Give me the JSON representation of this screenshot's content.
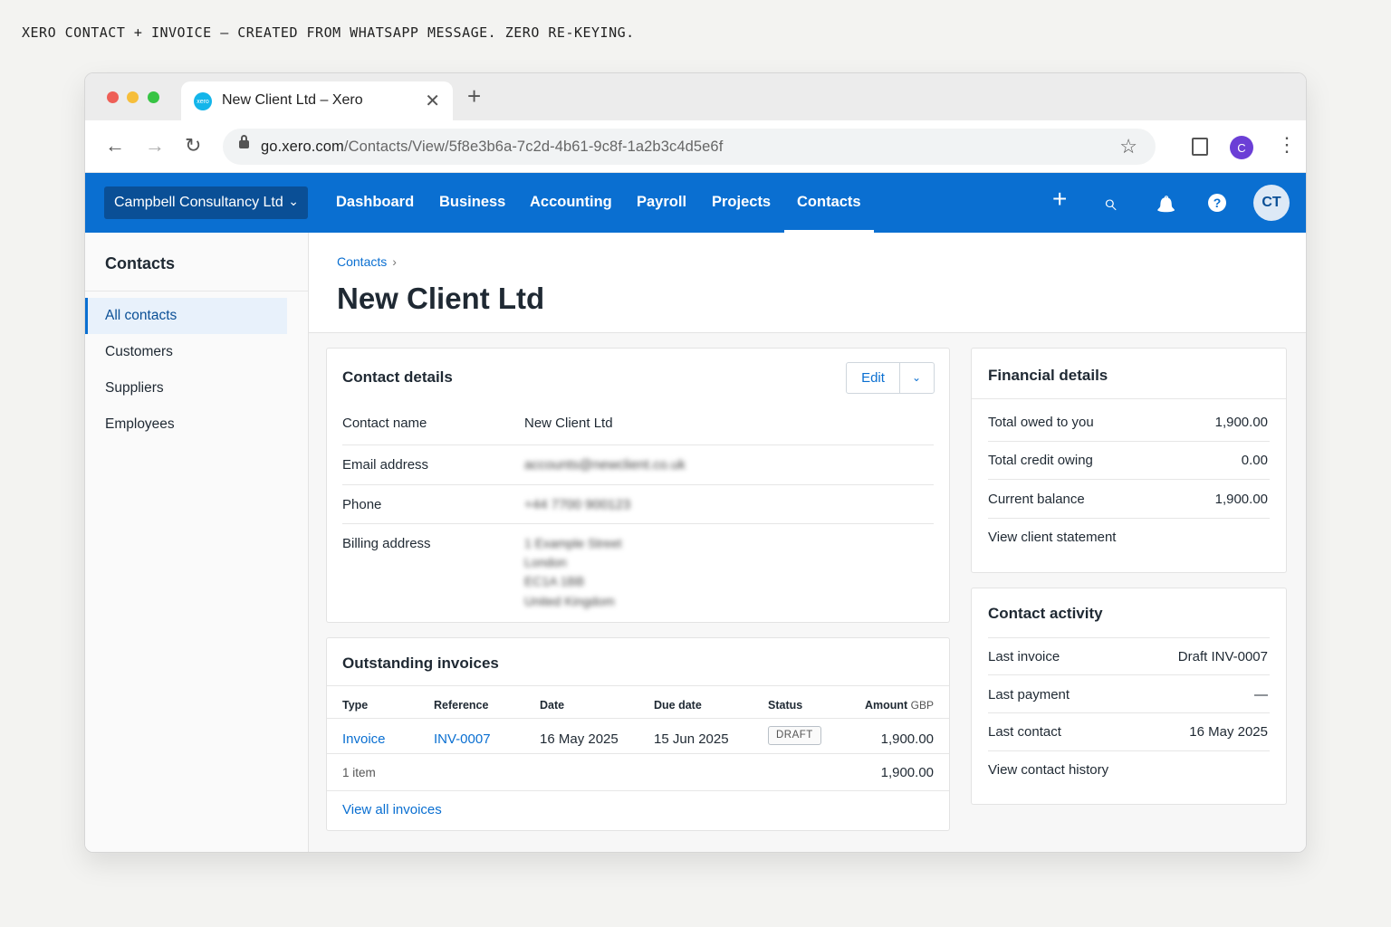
{
  "caption": "XERO CONTACT + INVOICE — CREATED FROM WHATSAPP MESSAGE. ZERO RE-KEYING.",
  "browser": {
    "tab_title": "New Client Ltd – Xero",
    "tab_icon_text": "xero",
    "tab_close": "✕",
    "new_tab": "+",
    "url_host": "go.xero.com",
    "url_path": "/Contacts/View/5f8e3b6a-7c2d-4b61-9c8f-1a2b3c4d5e6f",
    "profile_initial": "C",
    "back": "←",
    "forward": "→",
    "reload": "↻",
    "star": "☆",
    "menu": "⋮"
  },
  "header": {
    "org_name": "Campbell Consultancy Ltd",
    "org_chevron": "⌄",
    "nav": [
      "Dashboard",
      "Business",
      "Accounting",
      "Payroll",
      "Projects",
      "Contacts"
    ],
    "add": "+",
    "search": "⌕",
    "bell": "🔔",
    "help": "?",
    "avatar": "CT"
  },
  "sidebar": {
    "title": "Contacts",
    "items": [
      "All contacts",
      "Customers",
      "Suppliers",
      "Employees"
    ]
  },
  "page": {
    "breadcrumb": "Contacts",
    "breadcrumb_sep": "›",
    "title": "New Client Ltd"
  },
  "contact_details": {
    "title": "Contact details",
    "edit_label": "Edit",
    "edit_more": "⌄",
    "rows": [
      {
        "label": "Contact name",
        "value": "New Client Ltd"
      },
      {
        "label": "Email address",
        "value": "accounts@newclient.co.uk"
      },
      {
        "label": "Phone",
        "value": "+44 7700 900123"
      },
      {
        "label": "Billing address",
        "lines": [
          "1 Example Street",
          "London",
          "EC1A 1BB",
          "United Kingdom"
        ]
      }
    ]
  },
  "invoices": {
    "title": "Outstanding invoices",
    "columns": [
      "Type",
      "Reference",
      "Date",
      "Due date",
      "Status",
      "Amount"
    ],
    "amount_unit": "GBP",
    "rows": [
      {
        "type": "Invoice",
        "reference": "INV-0007",
        "date": "16 May 2025",
        "due": "15 Jun 2025",
        "status": "DRAFT",
        "amount": "1,900.00"
      }
    ],
    "count_label": "1 item",
    "total": "1,900.00",
    "view_all": "View all invoices"
  },
  "financial": {
    "title": "Financial details",
    "rows": [
      {
        "label": "Total owed to you",
        "value": "1,900.00"
      },
      {
        "label": "Total credit owing",
        "value": "0.00"
      },
      {
        "label": "Current balance",
        "value": "1,900.00"
      }
    ],
    "link": "View client statement"
  },
  "activity": {
    "title": "Contact activity",
    "rows": [
      {
        "label": "Last invoice",
        "value": "Draft INV-0007"
      },
      {
        "label": "Last payment",
        "value": "—"
      },
      {
        "label": "Last contact",
        "value": "16 May 2025"
      }
    ],
    "link": "View contact history"
  },
  "colors": {
    "xero_blue": "#0a6fd1",
    "org_button": "#0a4f96",
    "link": "#0a6fd1"
  }
}
